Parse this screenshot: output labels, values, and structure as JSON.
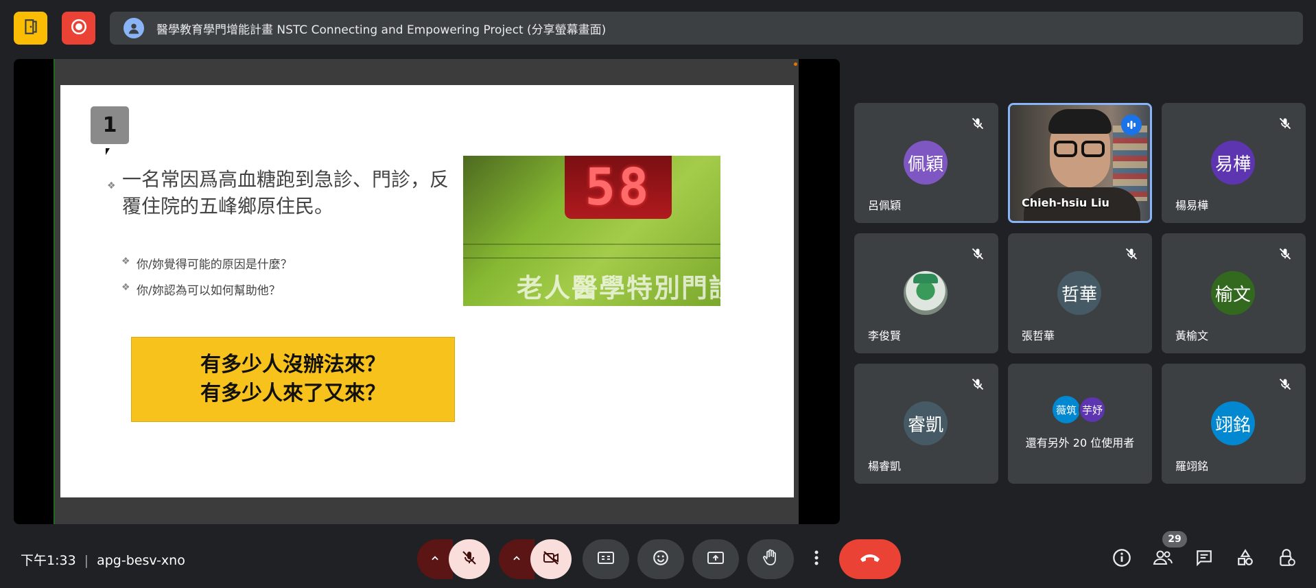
{
  "meeting": {
    "banner_text": "醫學教育學門增能計畫 NSTC Connecting and Empowering Project (分享螢幕畫面)",
    "time": "下午1:33",
    "code": "apg-besv-xno",
    "participant_count": "29"
  },
  "slide": {
    "number": "1",
    "bullet_main": "一名常因爲高血糖跑到急診、門診，反覆住院的五峰鄉原住民。",
    "bullet_sub1": "你/妳覺得可能的原因是什麼？",
    "bullet_sub2": "你/妳認為可以如何幫助他？",
    "photo_display": "58",
    "photo_sign": "老人醫學特別門診",
    "callout_line1": "有多少人沒辦法來？",
    "callout_line2": "有多少人來了又來？"
  },
  "participants": [
    {
      "initials": "佩穎",
      "name": "呂佩穎",
      "color": "#7e57c2"
    },
    {
      "initials": "",
      "name": "Chieh-hsiu Liu",
      "color": ""
    },
    {
      "initials": "易樺",
      "name": "楊易樺",
      "color": "#5e35b1"
    },
    {
      "initials": "",
      "name": "李俊賢",
      "color": "#6d7b6e"
    },
    {
      "initials": "哲華",
      "name": "張哲華",
      "color": "#455a64"
    },
    {
      "initials": "榆文",
      "name": "黃榆文",
      "color": "#33691e"
    },
    {
      "initials": "睿凱",
      "name": "楊睿凱",
      "color": "#455a64"
    },
    {
      "initials": "",
      "name": "還有另外 20 位使用者",
      "color": ""
    },
    {
      "initials": "翊銘",
      "name": "羅翊銘",
      "color": "#0288d1"
    }
  ],
  "more_avatars": [
    {
      "initials": "薇筑",
      "color": "#0288d1"
    },
    {
      "initials": "芋妤",
      "color": "#5e35b1"
    }
  ],
  "icons": {
    "left_top": "door-exit-icon",
    "record": "record-icon",
    "banner_user": "person-icon"
  },
  "colors": {
    "hangup": "#ea4335",
    "accent_speaking": "#8ab4f8",
    "record": "#ea4335",
    "app_btn": "#fbbc04"
  }
}
